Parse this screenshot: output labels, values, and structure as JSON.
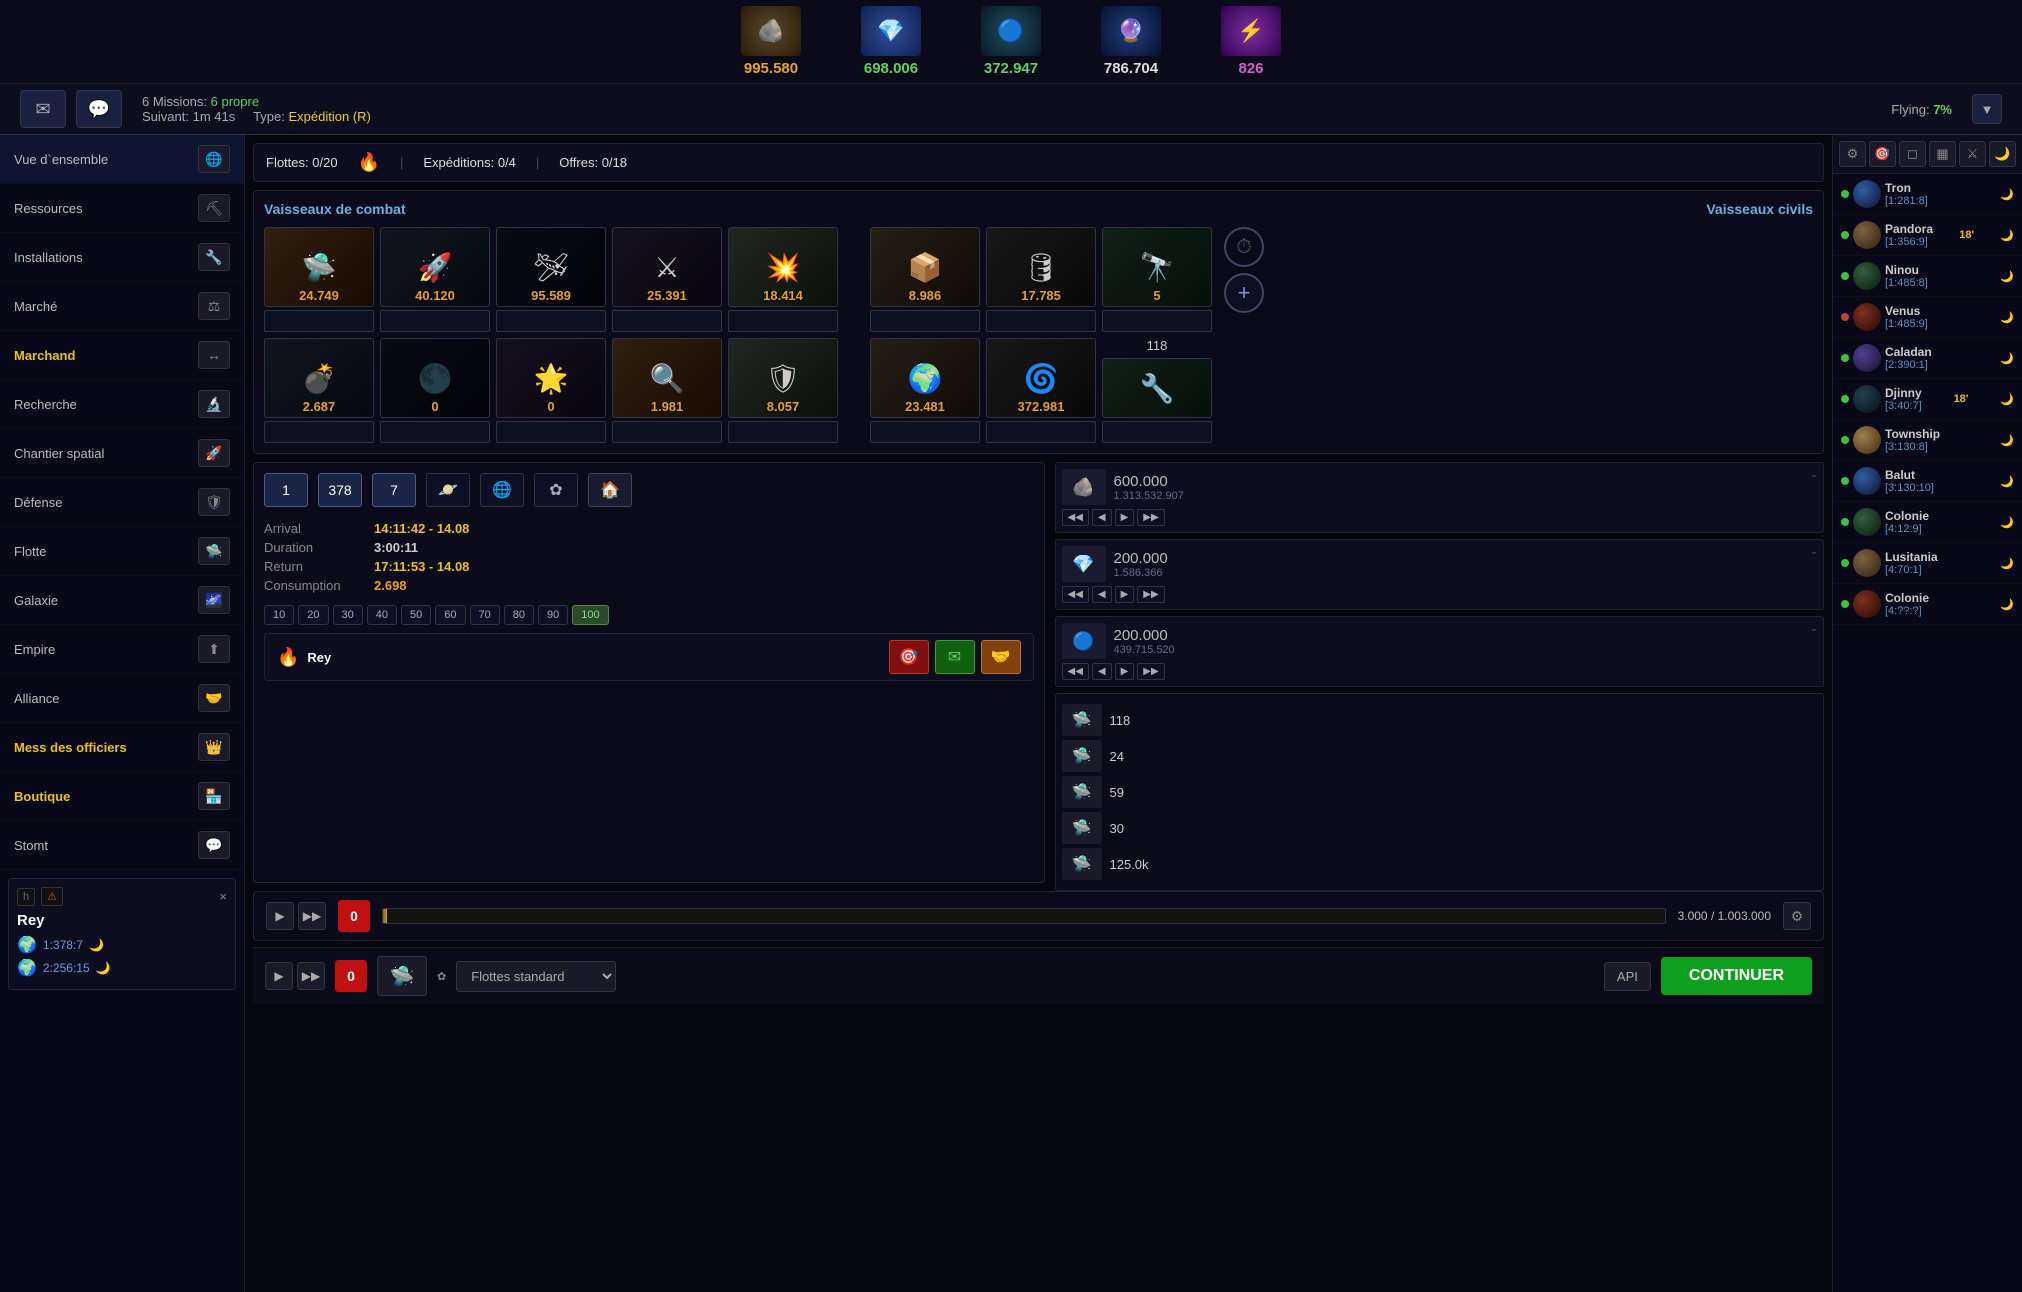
{
  "topBar": {
    "resources": [
      {
        "id": "metal",
        "icon": "🪨",
        "value": "995.580",
        "color": "yellow",
        "bgClass": "metal"
      },
      {
        "id": "crystal",
        "icon": "💎",
        "value": "698.006",
        "color": "green",
        "bgClass": "crystal"
      },
      {
        "id": "deut",
        "icon": "🔵",
        "value": "372.947",
        "color": "green",
        "bgClass": "deut"
      },
      {
        "id": "dm",
        "icon": "🔮",
        "value": "786.704",
        "color": "white",
        "bgClass": "dm"
      },
      {
        "id": "energy",
        "icon": "⚡",
        "value": "826",
        "color": "purple",
        "bgClass": "energy"
      }
    ]
  },
  "missionBar": {
    "missions_label": "6 Missions:",
    "missions_status": "6 propre",
    "suivant_label": "Suivant:",
    "suivant_value": "1m 41s",
    "type_label": "Type:",
    "type_value": "Expédition (R)",
    "flying_label": "Flying:",
    "flying_value": "7%"
  },
  "fleetStats": {
    "flottes_label": "Flottes:",
    "flottes_value": "0/20",
    "expeditions_label": "Expéditions:",
    "expeditions_value": "0/4",
    "offres_label": "Offres:",
    "offres_value": "0/18"
  },
  "shipsSection": {
    "combat_title": "Vaisseaux de combat",
    "civil_title": "Vaisseaux civils",
    "combatShips": [
      {
        "id": "lc",
        "count": "24.749",
        "bg": "bg1"
      },
      {
        "id": "hc",
        "count": "40.120",
        "bg": "bg2"
      },
      {
        "id": "cr",
        "count": "95.589",
        "bg": "bg3"
      },
      {
        "id": "bs",
        "count": "25.391",
        "bg": "bg4"
      },
      {
        "id": "dest",
        "count": "18.414",
        "bg": "bg5"
      }
    ],
    "civilShips": [
      {
        "id": "sc",
        "count": "8.986",
        "bg": "bg6"
      },
      {
        "id": "gc",
        "count": "17.785",
        "bg": "bg7"
      },
      {
        "id": "rec",
        "count": "5",
        "bg": "bg8"
      }
    ],
    "extraCombat": [
      {
        "id": "bomb",
        "count": "2.687",
        "bg": "bg2"
      },
      {
        "id": "destr",
        "count": "0",
        "bg": "bg3"
      },
      {
        "id": "ds",
        "count": "0",
        "bg": "bg4"
      },
      {
        "id": "esp",
        "count": "1.981",
        "bg": "bg1"
      },
      {
        "id": "bom",
        "count": "8.057",
        "bg": "bg5"
      }
    ],
    "extraCivil": [
      {
        "id": "col",
        "count": "23.481",
        "bg": "bg6"
      },
      {
        "id": "myst",
        "count": "372.981",
        "bg": "bg7"
      }
    ],
    "civilSpecial": {
      "count": "118",
      "bg": "bg8"
    }
  },
  "flightControls": {
    "num1": "1",
    "num2": "378",
    "num3": "7",
    "arrival_label": "Arrival",
    "arrival_value": "14:11:42 - 14.08",
    "duration_label": "Duration",
    "duration_value": "3:00:11",
    "return_label": "Return",
    "return_value": "17:11:53 - 14.08",
    "consumption_label": "Consumption",
    "consumption_value": "2.698",
    "speeds": [
      "10",
      "20",
      "30",
      "40",
      "50",
      "60",
      "70",
      "80",
      "90",
      "100"
    ]
  },
  "cargo": [
    {
      "icon": "🪨",
      "value": "600.000",
      "sub": "1.313.532.907",
      "bg": "bg1"
    },
    {
      "icon": "💎",
      "value": "200.000",
      "sub": "1.586.366",
      "bg": "crystal"
    },
    {
      "icon": "🔵",
      "value": "200.000",
      "sub": "439.715.520",
      "bg": "deut"
    }
  ],
  "sendUnits": [
    {
      "count": "118",
      "icon": "🛸"
    },
    {
      "count": "24",
      "icon": "🛸"
    },
    {
      "count": "59",
      "icon": "🛸"
    },
    {
      "count": "30",
      "icon": "🛸"
    },
    {
      "count": "125.0k",
      "icon": "🛸"
    }
  ],
  "targetBar": {
    "progress_current": "3.000",
    "progress_max": "1.003.000",
    "progress_pct": 0.3
  },
  "playerFire": {
    "fire_icon": "🔥",
    "name": "Rey"
  },
  "bottomBar": {
    "fleet_standard": "Flottes standard",
    "api_label": "API",
    "continue_label": "CONTINUER"
  },
  "sidebar": {
    "items": [
      {
        "label": "Vue d`ensemble",
        "icon": "🌐",
        "active": true
      },
      {
        "label": "Ressources",
        "icon": "⛏"
      },
      {
        "label": "Installations",
        "icon": "🦇"
      },
      {
        "label": "Marché",
        "icon": "⚖"
      },
      {
        "label": "Marchand",
        "icon": "↔",
        "highlight": "yellow"
      },
      {
        "label": "Recherche",
        "icon": "🔬"
      },
      {
        "label": "Chantier spatial",
        "icon": "🚀"
      },
      {
        "label": "Défense",
        "icon": "🛡"
      },
      {
        "label": "Flotte",
        "icon": "🛸"
      },
      {
        "label": "Galaxie",
        "icon": "🌌"
      },
      {
        "label": "Empire",
        "icon": "⬆"
      },
      {
        "label": "Alliance",
        "icon": "🤝"
      },
      {
        "label": "Mess des officiers",
        "icon": "👑",
        "highlight": "yellow"
      },
      {
        "label": "Boutique",
        "icon": "🏪",
        "highlight": "yellow"
      },
      {
        "label": "Stomt",
        "icon": "💬"
      }
    ]
  },
  "playerCard": {
    "name": "Rey",
    "close": "×",
    "planets": [
      {
        "coords": "1:378:7",
        "moon": "🌙",
        "alert": "h"
      },
      {
        "coords": "2:256:15",
        "moon": "🌙"
      }
    ]
  },
  "rightPanel": {
    "icons": [
      "⚙",
      "🎯",
      "◻",
      "▦",
      "⚔",
      "🌙"
    ],
    "planets": [
      {
        "name": "Tron",
        "coords": "[1:281:8]",
        "dot": "green",
        "moon": true
      },
      {
        "name": "Pandora",
        "coords": "[1:356:9]",
        "dot": "green",
        "timer": "18'",
        "moon": true
      },
      {
        "name": "Ninou",
        "coords": "[1:485:8]",
        "dot": "green",
        "moon": true
      },
      {
        "name": "Venus",
        "coords": "[1:485:9]",
        "dot": "red",
        "moon": true
      },
      {
        "name": "Caladan",
        "coords": "[2:390:1]",
        "dot": "green",
        "moon": true
      },
      {
        "name": "Djinny",
        "coords": "[3:40:7]",
        "dot": "green",
        "timer": "18'",
        "moon": true
      },
      {
        "name": "Township",
        "coords": "[3:130:8]",
        "dot": "green",
        "moon": true
      },
      {
        "name": "Balut",
        "coords": "[3:130:10]",
        "dot": "green",
        "moon": true
      },
      {
        "name": "Colonie",
        "coords": "[4:12:9]",
        "dot": "green",
        "moon": true
      },
      {
        "name": "Lusitania",
        "coords": "[4:70:1]",
        "dot": "green",
        "moon": true
      },
      {
        "name": "Colonie",
        "coords": "[4:??:?]",
        "dot": "green",
        "moon": true
      }
    ]
  }
}
